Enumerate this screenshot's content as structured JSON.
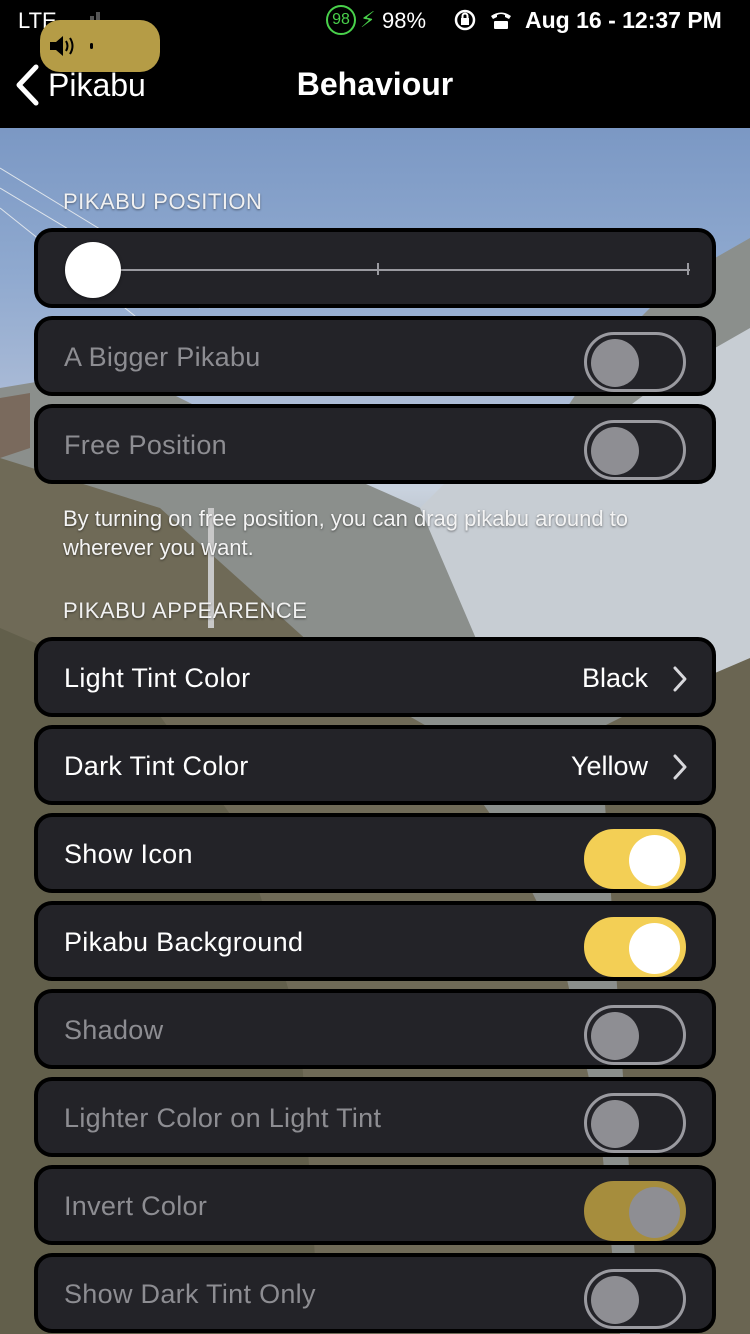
{
  "status_bar": {
    "carrier": "LTE",
    "battery_ring_value": "98",
    "battery_percent": "98%",
    "datetime": "Aug 16 - 12:37 PM"
  },
  "nav": {
    "back_label": "Pikabu",
    "title": "Behaviour"
  },
  "position_section": {
    "header": "PIKABU POSITION",
    "slider_value_fraction": 0,
    "rows": [
      {
        "label": "A Bigger Pikabu",
        "enabled": false,
        "toggle": "off"
      },
      {
        "label": "Free Position",
        "enabled": false,
        "toggle": "off"
      }
    ],
    "footer": "By turning on free position, you can drag pikabu around to wherever you want."
  },
  "appearance_section": {
    "header": "PIKABU APPEARENCE",
    "rows": [
      {
        "label": "Light Tint Color",
        "value": "Black"
      },
      {
        "label": "Dark Tint Color",
        "value": "Yellow"
      },
      {
        "label": "Show Icon",
        "toggle": "on"
      },
      {
        "label": "Pikabu Background",
        "toggle": "on"
      },
      {
        "label": "Shadow",
        "toggle": "off",
        "enabled": false
      },
      {
        "label": "Lighter Color on Light Tint",
        "toggle": "off",
        "enabled": false
      },
      {
        "label": "Invert Color",
        "toggle": "on",
        "enabled": false
      },
      {
        "label": "Show Dark Tint Only",
        "toggle": "off",
        "enabled": false
      }
    ]
  },
  "colors": {
    "accent_toggle": "#f3cf55",
    "card_background": "#232328",
    "battery_green": "#49d14b"
  }
}
